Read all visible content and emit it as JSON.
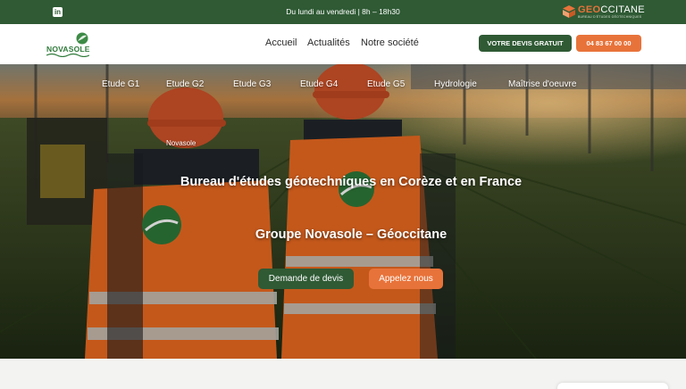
{
  "topbar": {
    "social_icon": "linkedin-icon",
    "social_label": "in",
    "hours": "Du lundi au vendredi | 8h – 18h30",
    "partner_logo": {
      "name_part1": "GEO",
      "name_part2": "CCITANE",
      "tagline": "BUREAU D'ÉTUDES GÉOTECHNIQUES"
    }
  },
  "header": {
    "logo_text": "NOVASOLE",
    "nav": [
      "Accueil",
      "Actualités",
      "Notre société"
    ],
    "cta_quote": "VOTRE DEVIS GRATUIT",
    "cta_phone": "04 83 67 00 00"
  },
  "hero": {
    "subnav": [
      "Etude G1",
      "Etude G2",
      "Etude G3",
      "Etude G4",
      "Etude G5",
      "Hydrologie",
      "Maîtrise d'oeuvre"
    ],
    "breadcrumb": "Novasole",
    "title": "Bureau d'études géotechniques en Corèze et en France",
    "subtitle": "Groupe Novasole – Géoccitane",
    "button_quote": "Demande de devis",
    "button_call": "Appelez nous"
  },
  "colors": {
    "brand_green": "#2f5a34",
    "accent_orange": "#e8733a",
    "logo_green": "#2f7a3a"
  }
}
